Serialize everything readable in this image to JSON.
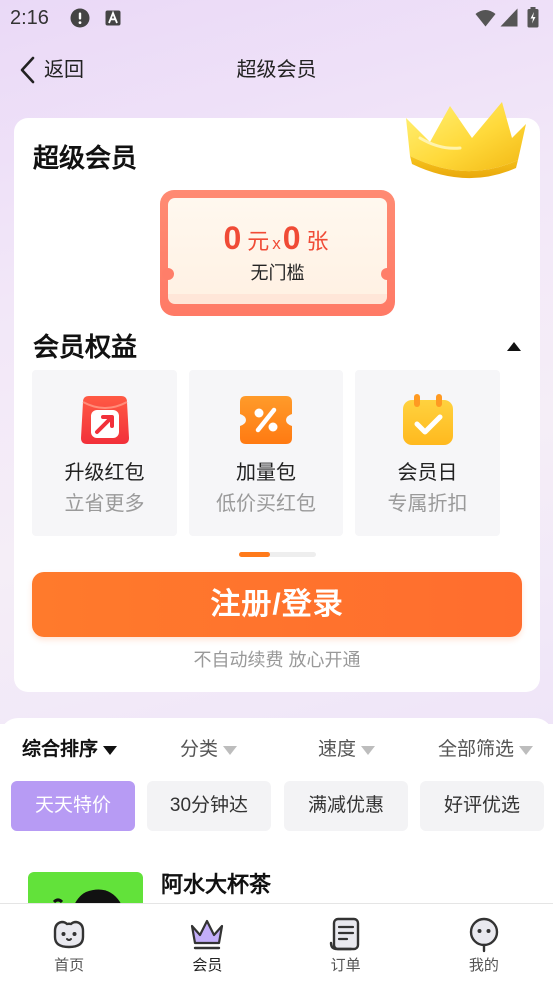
{
  "status_bar": {
    "time": "2:16",
    "icons": [
      "alert-icon",
      "text-a-icon",
      "wifi-icon",
      "signal-icon",
      "battery-icon"
    ]
  },
  "header": {
    "back_label": "返回",
    "title": "超级会员"
  },
  "member_card": {
    "title": "超级会员",
    "coupon": {
      "amount": "0",
      "amount_unit": "元",
      "times": "x",
      "count": "0",
      "count_unit": "张",
      "condition": "无门槛"
    },
    "benefits_title": "会员权益",
    "benefits": [
      {
        "icon": "upgrade-redpacket-icon",
        "title": "升级红包",
        "subtitle": "立省更多"
      },
      {
        "icon": "percent-ticket-icon",
        "title": "加量包",
        "subtitle": "低价买红包"
      },
      {
        "icon": "calendar-check-icon",
        "title": "会员日",
        "subtitle": "专属折扣"
      }
    ],
    "carousel_indicator": {
      "position_fraction": 0.0,
      "visible_fraction": 0.4
    },
    "cta_label": "注册/登录",
    "cta_note": "不自动续费 放心开通"
  },
  "filters": {
    "sort": [
      {
        "label": "综合排序",
        "active": true
      },
      {
        "label": "分类",
        "active": false
      },
      {
        "label": "速度",
        "active": false
      },
      {
        "label": "全部筛选",
        "active": false
      }
    ],
    "chips": [
      {
        "label": "天天特价",
        "active": true
      },
      {
        "label": "30分钟达",
        "active": false
      },
      {
        "label": "满减优惠",
        "active": false
      },
      {
        "label": "好评优选",
        "active": false
      }
    ]
  },
  "store": {
    "name": "阿水大杯茶"
  },
  "bottom_nav": [
    {
      "label": "首页",
      "icon": "home-pet-icon",
      "active": false
    },
    {
      "label": "会员",
      "icon": "crown-icon",
      "active": true
    },
    {
      "label": "订单",
      "icon": "order-receipt-icon",
      "active": false
    },
    {
      "label": "我的",
      "icon": "profile-face-icon",
      "active": false
    }
  ],
  "colors": {
    "accent": "#FF6D2E",
    "chip_active": "#B79BF4",
    "coupon_red": "#F04B36",
    "indicator": "#FF7A1A"
  }
}
